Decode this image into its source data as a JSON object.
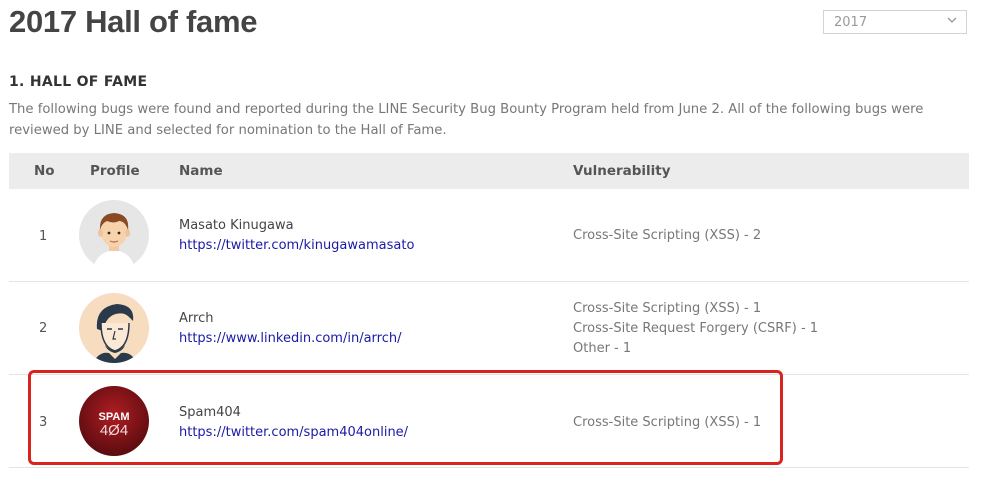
{
  "header": {
    "title": "2017 Hall of fame",
    "year_select": {
      "selected": "2017"
    }
  },
  "section": {
    "title": "1. HALL OF FAME",
    "intro": "The following bugs were found and reported during the LINE Security Bug Bounty Program held from June 2. All of the following bugs were reviewed by LINE and selected for nomination to the Hall of Fame."
  },
  "table": {
    "columns": [
      "No",
      "Profile",
      "Name",
      "Vulnerability"
    ],
    "rows": [
      {
        "no": "1",
        "name": "Masato Kinugawa",
        "link": "https://twitter.com/kinugawamasato",
        "vulnerabilities": [
          "Cross-Site Scripting (XSS) - 2"
        ],
        "avatar": "cartoon-man-avatar"
      },
      {
        "no": "2",
        "name": "Arrch",
        "link": "https://www.linkedin.com/in/arrch/",
        "vulnerabilities": [
          "Cross-Site Scripting (XSS) - 1",
          "Cross-Site Request Forgery (CSRF) - 1",
          "Other - 1"
        ],
        "avatar": "sketch-face-avatar"
      },
      {
        "no": "3",
        "name": "Spam404",
        "link": "https://twitter.com/spam404online/",
        "vulnerabilities": [
          "Cross-Site Scripting (XSS) - 1"
        ],
        "avatar": "spam404-logo-avatar",
        "avatar_text": [
          "SPAM",
          "4Ø4"
        ]
      }
    ]
  },
  "colors": {
    "highlight": "#d9231f",
    "link": "#1a1aa8",
    "header_bg": "#ececec"
  }
}
